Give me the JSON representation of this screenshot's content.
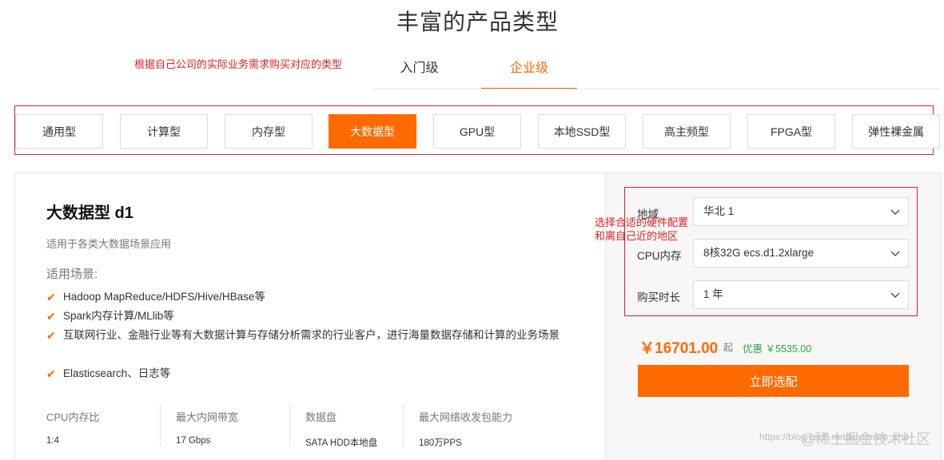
{
  "page": {
    "title": "丰富的产品类型"
  },
  "annotations": {
    "top": "根据自己公司的实际业务需求购买对应的类型",
    "right_line1": "选择合适的硬件配置",
    "right_line2": "和离自己近的地区"
  },
  "level_tabs": [
    {
      "label": "入门级"
    },
    {
      "label": "企业级",
      "active": true
    }
  ],
  "types": [
    {
      "label": "通用型"
    },
    {
      "label": "计算型"
    },
    {
      "label": "内存型"
    },
    {
      "label": "大数据型",
      "active": true
    },
    {
      "label": "GPU型"
    },
    {
      "label": "本地SSD型"
    },
    {
      "label": "高主频型"
    },
    {
      "label": "FPGA型"
    },
    {
      "label": "弹性裸金属"
    }
  ],
  "product": {
    "name": "大数据型 d1",
    "description": "适用于各类大数据场景应用",
    "scenarios_title": "适用场景:",
    "scenarios": [
      "Hadoop MapReduce/HDFS/Hive/HBase等",
      "Spark内存计算/MLlib等",
      "互联网行业、金融行业等有大数据计算与存储分析需求的行业客户，进行海量数据存储和计算的业务场景",
      "Elasticsearch、日志等"
    ],
    "specs": [
      {
        "label": "CPU内存比",
        "value": "1:4"
      },
      {
        "label": "最大内网带宽",
        "value": "17 Gbps"
      },
      {
        "label": "数据盘",
        "value": "SATA HDD本地盘"
      },
      {
        "label": "最大网络收发包能力",
        "value": "180万PPS"
      }
    ]
  },
  "config": {
    "region": {
      "label": "地域",
      "value": "华北 1"
    },
    "cpu": {
      "label": "CPU内存",
      "value": "8核32G ecs.d1.2xlarge"
    },
    "duration": {
      "label": "购买时长",
      "value": "1 年"
    }
  },
  "pricing": {
    "price": "￥16701.00",
    "unit": "起",
    "discount": "优惠 ￥5535.00",
    "buy_label": "立即选配"
  },
  "watermark": {
    "url": "https://blog.csdn.net/liuyimson_zhu",
    "brand": "@稀土掘金技术社区"
  },
  "colors": {
    "accent": "#ff6a00",
    "annotation": "#e02020",
    "discount": "#28a745"
  }
}
